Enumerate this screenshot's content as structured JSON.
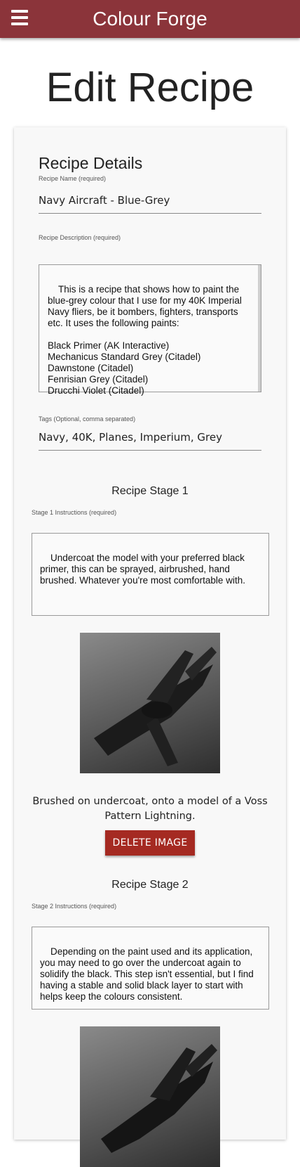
{
  "header": {
    "app_title": "Colour Forge",
    "menu_icon": "hamburger-menu-icon"
  },
  "page": {
    "title": "Edit Recipe"
  },
  "details": {
    "section_title": "Recipe Details",
    "name_label": "Recipe Name (required)",
    "name_value": "Navy Aircraft - Blue-Grey",
    "description_label": "Recipe Description (required)",
    "description_value": "This is a recipe that shows how to paint the blue-grey colour that I use for my 40K Imperial Navy fliers, be it bombers, fighters, transports etc. It uses the following paints:\n\nBlack Primer (AK Interactive)\nMechanicus Standard Grey (Citadel)\nDawnstone (Citadel)\nFenrisian Grey (Citadel)\nDrucchi Violet (Citadel)",
    "tags_label": "Tags (Optional, comma separated)",
    "tags_value": "Navy, 40K, Planes, Imperium, Grey"
  },
  "stages": [
    {
      "title": "Recipe Stage 1",
      "instructions_label": "Stage 1 Instructions (required)",
      "instructions": "Undercoat the model with your preferred black primer, this can be sprayed, airbrushed, hand brushed. Whatever you're most comfortable with.",
      "image_caption": "Brushed on undercoat, onto a model of a Voss Pattern Lightning.",
      "delete_label": "DELETE IMAGE"
    },
    {
      "title": "Recipe Stage 2",
      "instructions_label": "Stage 2 Instructions (required)",
      "instructions": "Depending on the paint used and its application, you may need to go over the undercoat again to solidify the black. This step isn't essential, but I find having a stable and solid black layer to start with helps keep the colours consistent."
    }
  ],
  "colors": {
    "header_bg": "#8b343a",
    "delete_button": "#a52a22"
  }
}
